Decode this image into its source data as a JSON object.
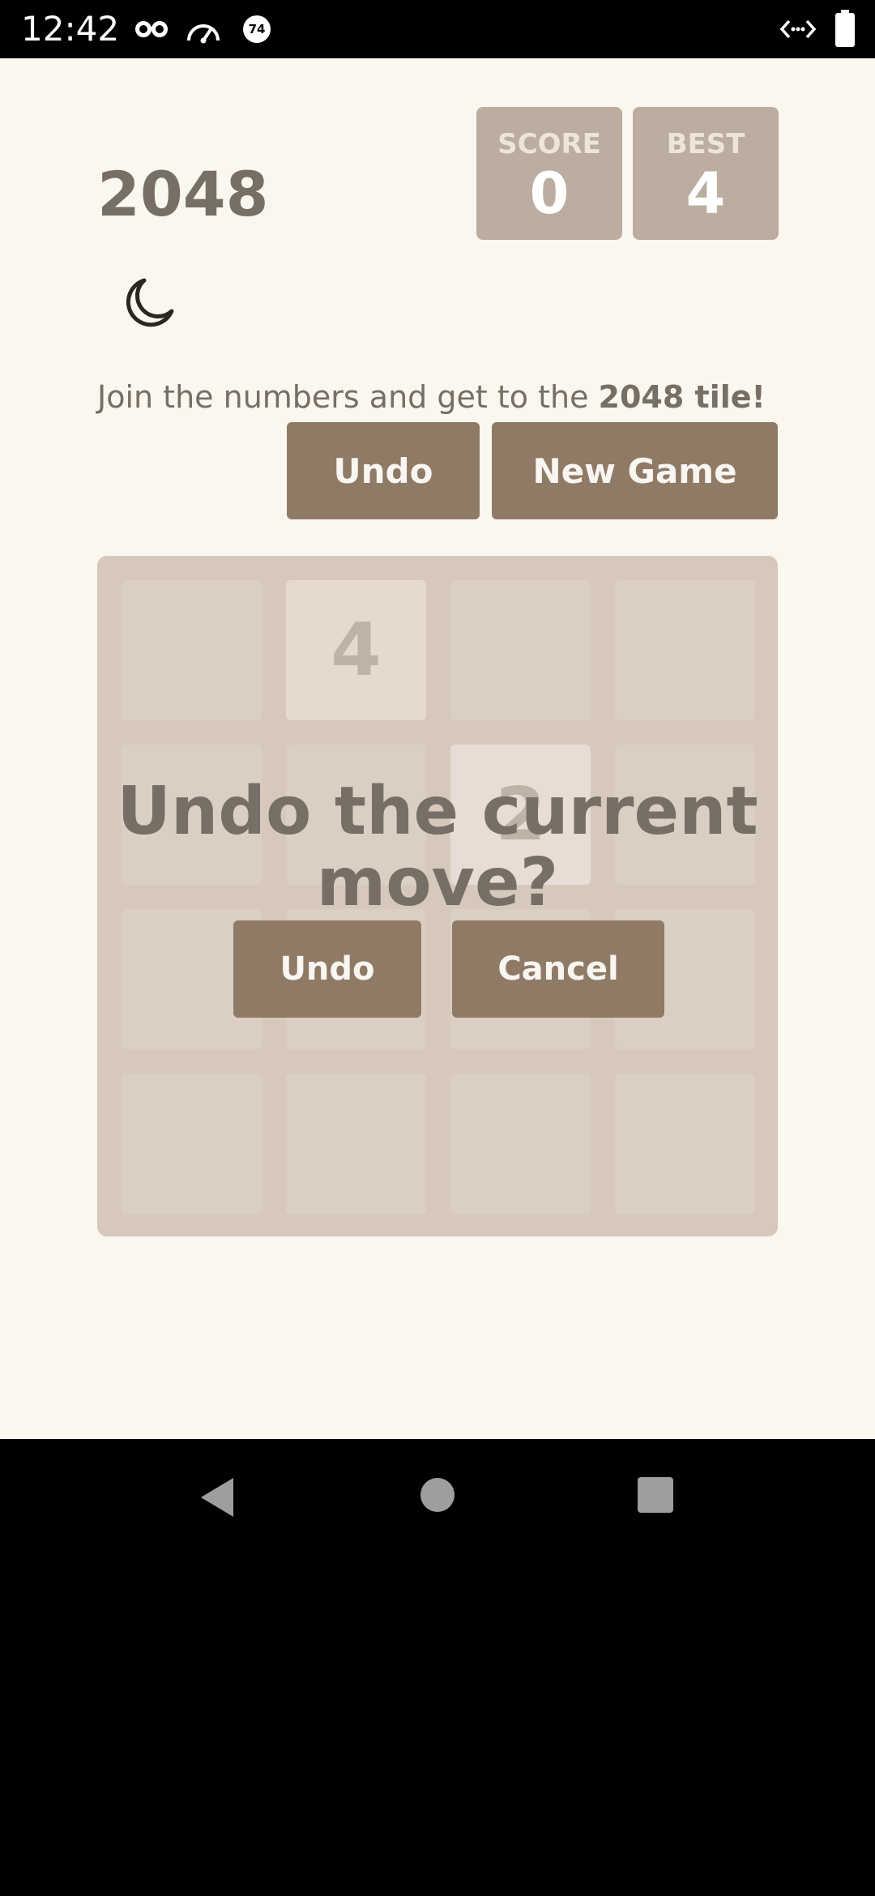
{
  "status_bar": {
    "time": "12:42",
    "icons": [
      "incognito-icon",
      "speedometer-icon",
      "temperature-badge-icon",
      "code-icon",
      "battery-icon"
    ],
    "badge_value": "74"
  },
  "header": {
    "title": "2048",
    "score_label": "SCORE",
    "score_value": "0",
    "best_label": "BEST",
    "best_value": "4"
  },
  "theme_toggle": {
    "icon": "moon-icon"
  },
  "intro": {
    "text": "Join the numbers and get to the ",
    "bold": "2048 tile!"
  },
  "controls": {
    "undo_label": "Undo",
    "new_game_label": "New Game"
  },
  "board": {
    "size": 4,
    "tiles": [
      {
        "row": 0,
        "col": 1,
        "value": "4"
      },
      {
        "row": 1,
        "col": 2,
        "value": "2"
      }
    ]
  },
  "dialog": {
    "message": "Undo the current move?",
    "confirm_label": "Undo",
    "cancel_label": "Cancel"
  },
  "nav_bar": {
    "icons": [
      "back-icon",
      "home-icon",
      "recents-icon"
    ]
  },
  "colors": {
    "background": "#faf7ef",
    "board": "#d6c9bc",
    "cell": "#ded3c7",
    "button": "#8f7a66",
    "score_box": "#bbada0",
    "text": "#776e65"
  }
}
